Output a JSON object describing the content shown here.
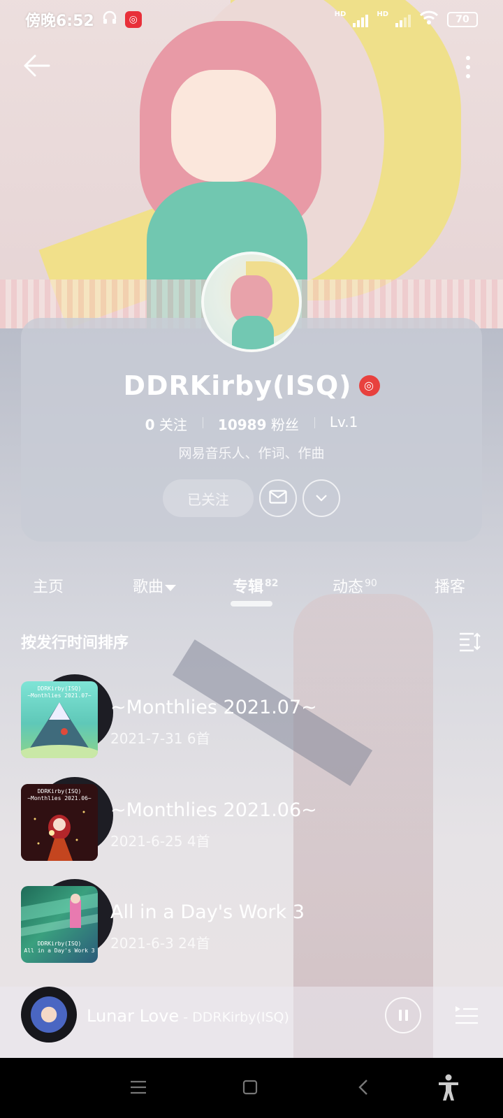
{
  "status_bar": {
    "time": "傍晚6:52",
    "battery": "70",
    "signal_label_1": "HD",
    "signal_label_2": "HD",
    "icons": [
      "headphones-icon",
      "netease-music-icon",
      "signal-icon",
      "wifi-icon",
      "battery-icon"
    ]
  },
  "header": {
    "back_icon": "arrow-left-icon",
    "more_icon": "more-vertical-icon"
  },
  "profile": {
    "name": "DDRKirby(ISQ)",
    "verified_icon": "netease-verified-icon",
    "following_count": "0",
    "following_label": "关注",
    "followers_count": "10989",
    "followers_label": "粉丝",
    "level": "Lv.1",
    "bio": "网易音乐人、作词、作曲",
    "follow_button": "已关注",
    "message_icon": "mail-icon",
    "expand_icon": "chevron-down-icon"
  },
  "tabs": [
    {
      "label": "主页",
      "badge": ""
    },
    {
      "label": "歌曲",
      "badge": ""
    },
    {
      "label": "专辑",
      "badge": "82"
    },
    {
      "label": "动态",
      "badge": "90"
    },
    {
      "label": "播客",
      "badge": ""
    }
  ],
  "active_tab": "专辑",
  "sort": {
    "label": "按发行时间排序",
    "icon": "sort-icon"
  },
  "albums": [
    {
      "title": "~Monthlies 2021.07~",
      "date": "2021-7-31",
      "count": "6首",
      "cover_text": "DDRKirby(ISQ)\n~Monthlies 2021.07~"
    },
    {
      "title": "~Monthlies 2021.06~",
      "date": "2021-6-25",
      "count": "4首",
      "cover_text": "DDRKirby(ISQ)\n~Monthlies 2021.06~"
    },
    {
      "title": "All in a Day's Work 3",
      "date": "2021-6-3",
      "count": "24首",
      "cover_text": "DDRKirby(ISQ)\nAll in a Day's Work 3"
    }
  ],
  "now_playing": {
    "title": "Lunar Love",
    "separator": " - ",
    "artist": "DDRKirby(ISQ)",
    "play_icon": "pause-icon",
    "playlist_icon": "playlist-icon"
  },
  "colors": {
    "accent": "#e8413e",
    "card_bg": "#c8ccd6",
    "nav_bar": "#000000"
  }
}
